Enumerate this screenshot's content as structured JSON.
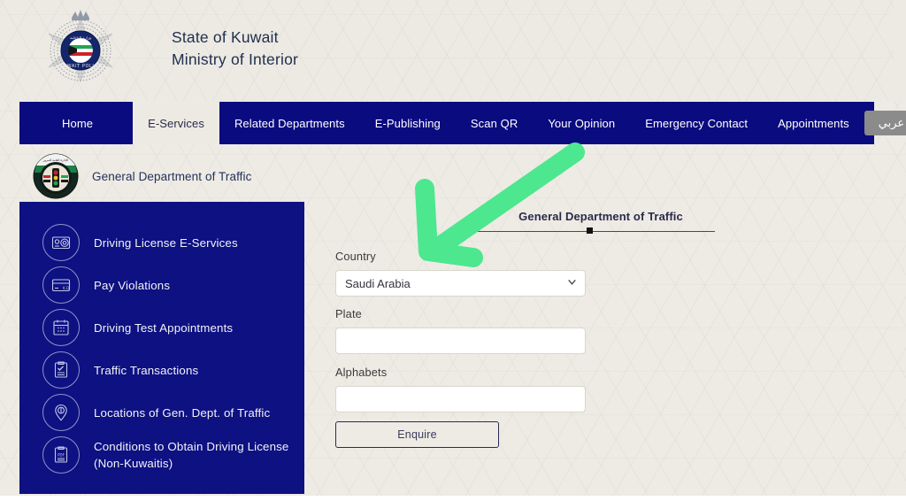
{
  "header": {
    "emblem_name": "kuwait-police-emblem",
    "title_line1": "State of Kuwait",
    "title_line2": "Ministry of Interior"
  },
  "nav": {
    "items": [
      {
        "label": "Home",
        "active": false
      },
      {
        "label": "E-Services",
        "active": true
      },
      {
        "label": "Related Departments",
        "active": false
      },
      {
        "label": "E-Publishing",
        "active": false
      },
      {
        "label": "Scan QR",
        "active": false
      },
      {
        "label": "Your Opinion",
        "active": false
      },
      {
        "label": "Emergency Contact",
        "active": false
      },
      {
        "label": "Appointments",
        "active": false
      }
    ],
    "language_button": "عربي",
    "bar_color": "#0b0b80",
    "active_bg": "#edeae3"
  },
  "breadcrumb": {
    "logo_name": "general-department-of-traffic-logo",
    "label": "General Department of Traffic"
  },
  "sidebar": {
    "bg_color": "#0e1181",
    "items": [
      {
        "label": "Driving License E-Services",
        "icon": "license-card-icon"
      },
      {
        "label": "Pay Violations",
        "icon": "payment-card-kd-icon"
      },
      {
        "label": "Driving Test Appointments",
        "icon": "calendar-icon"
      },
      {
        "label": "Traffic Transactions",
        "icon": "clipboard-check-icon"
      },
      {
        "label": "Locations of Gen. Dept. of Traffic",
        "icon": "map-pin-icon"
      },
      {
        "label": "Conditions to Obtain Driving License (Non-Kuwaitis)",
        "icon": "pdf-document-icon"
      }
    ]
  },
  "main": {
    "section_title": "General Department of Traffic",
    "fields": {
      "country_label": "Country",
      "country_value": "Saudi Arabia",
      "plate_label": "Plate",
      "plate_value": "",
      "plate_placeholder": "",
      "alphabets_label": "Alphabets",
      "alphabets_value": "",
      "alphabets_placeholder": ""
    },
    "submit_label": "Enquire"
  },
  "annotation": {
    "type": "arrow",
    "color": "#4de78f",
    "points_to": "country-select",
    "direction": "down-left"
  },
  "colors": {
    "page_bg": "#eeebe4",
    "navy": "#0b0b80",
    "sidebar_blue": "#0e1181",
    "text_dark": "#2a2a4a"
  }
}
